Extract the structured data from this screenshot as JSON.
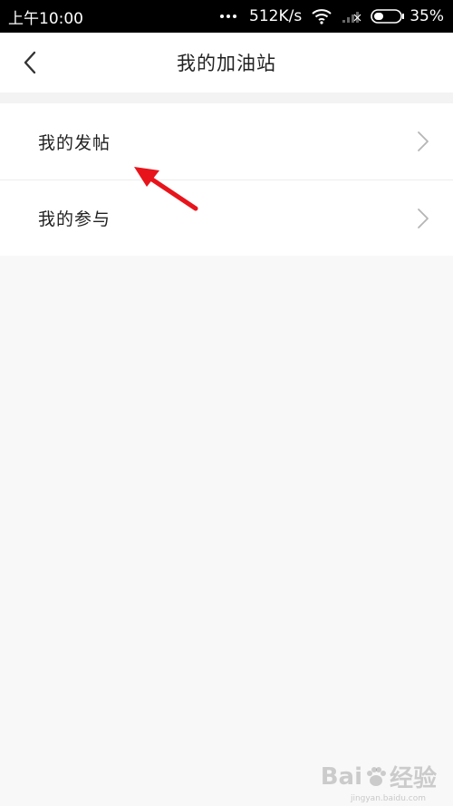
{
  "status_bar": {
    "time": "上午10:00",
    "network_speed": "512K/s",
    "battery": "35%",
    "icons": [
      "more-dots-icon",
      "wifi-icon",
      "signal-icon",
      "battery-icon"
    ]
  },
  "header": {
    "title": "我的加油站",
    "back_icon": "chevron-left-icon"
  },
  "list": {
    "items": [
      {
        "label": "我的发帖"
      },
      {
        "label": "我的参与"
      }
    ]
  },
  "annotation": {
    "color": "#e8141b"
  },
  "watermark": {
    "brand": "Bai",
    "brand_suffix": "经验",
    "url": "jingyan.baidu.com"
  },
  "colors": {
    "status_bar_bg": "#000000",
    "page_bg": "#f8f8f8",
    "card_bg": "#ffffff",
    "text": "#222222",
    "chevron": "#b5b5b5"
  }
}
